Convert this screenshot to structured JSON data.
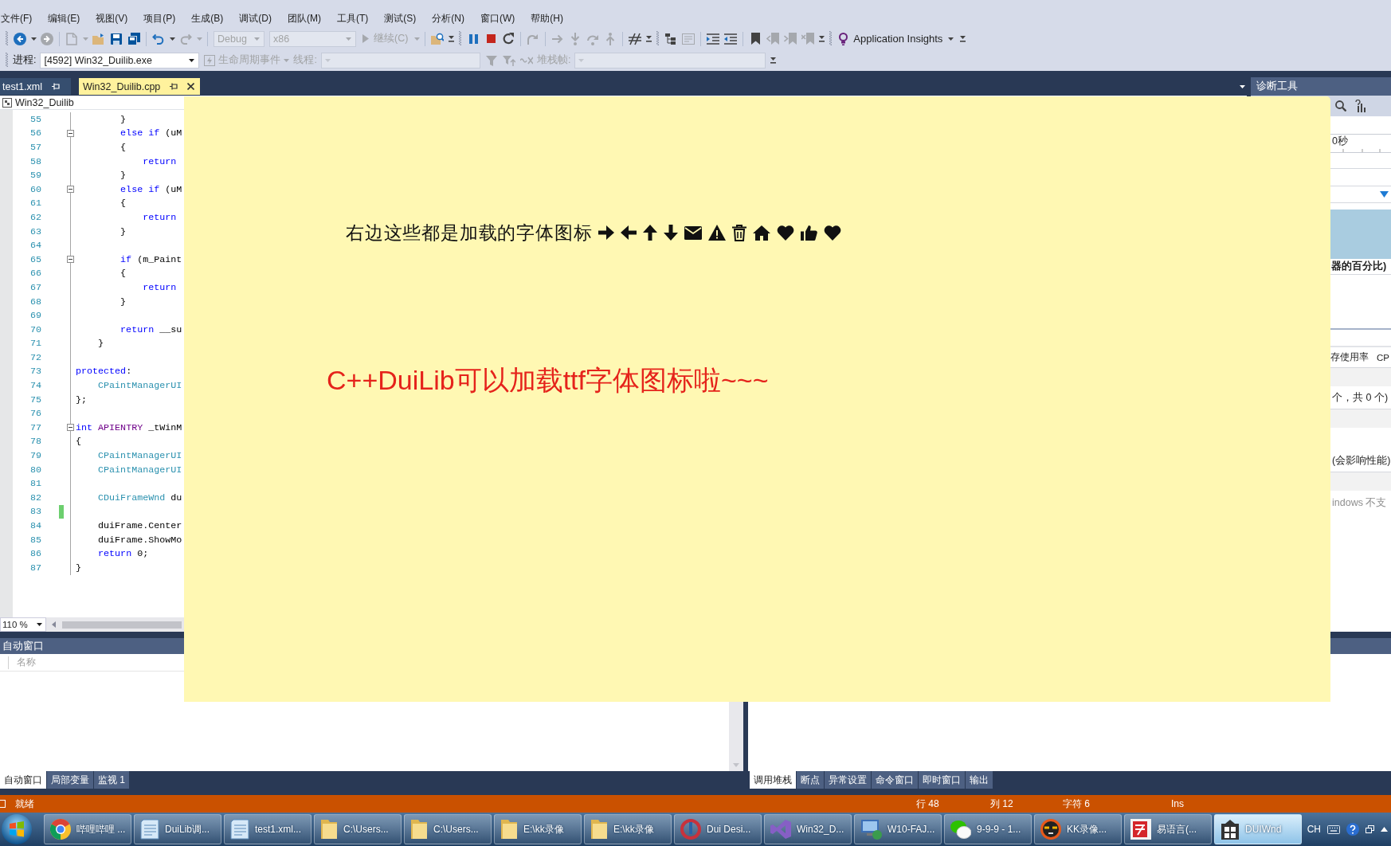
{
  "menu": [
    "文件(F)",
    "编辑(E)",
    "视图(V)",
    "项目(P)",
    "生成(B)",
    "调试(D)",
    "团队(M)",
    "工具(T)",
    "测试(S)",
    "分析(N)",
    "窗口(W)",
    "帮助(H)"
  ],
  "toolbar": [
    {
      "kind": "grip"
    },
    {
      "kind": "back",
      "disabled": false
    },
    {
      "kind": "caret",
      "disabled": false
    },
    {
      "kind": "forward",
      "disabled": true
    },
    {
      "kind": "separator"
    },
    {
      "kind": "new-project",
      "disabled": true
    },
    {
      "kind": "caret",
      "disabled": true
    },
    {
      "kind": "open",
      "disabled": false
    },
    {
      "kind": "save",
      "disabled": false
    },
    {
      "kind": "save-all",
      "disabled": false
    },
    {
      "kind": "separator"
    },
    {
      "kind": "undo",
      "disabled": false
    },
    {
      "kind": "caret",
      "disabled": false
    },
    {
      "kind": "redo",
      "disabled": true
    },
    {
      "kind": "caret",
      "disabled": true
    },
    {
      "kind": "separator"
    },
    {
      "kind": "combo",
      "label": "Debug",
      "disabled": true
    },
    {
      "kind": "combo",
      "label": "x86",
      "disabled": true
    },
    {
      "kind": "run",
      "label": "继续(C)",
      "disabled": true
    },
    {
      "kind": "caret",
      "disabled": true
    },
    {
      "kind": "separator"
    },
    {
      "kind": "find",
      "disabled": false
    },
    {
      "kind": "overflow"
    },
    {
      "kind": "grip"
    },
    {
      "kind": "pause",
      "disabled": false
    },
    {
      "kind": "stop",
      "disabled": false
    },
    {
      "kind": "restart",
      "disabled": false
    },
    {
      "kind": "separator"
    },
    {
      "kind": "show-next",
      "disabled": true
    },
    {
      "kind": "separator"
    },
    {
      "kind": "step-right",
      "disabled": true
    },
    {
      "kind": "step-into",
      "disabled": true
    },
    {
      "kind": "step-over",
      "disabled": true
    },
    {
      "kind": "step-out",
      "disabled": true
    },
    {
      "kind": "separator"
    },
    {
      "kind": "hex",
      "disabled": false
    },
    {
      "kind": "overflow"
    },
    {
      "kind": "grip"
    },
    {
      "kind": "threads",
      "disabled": false
    },
    {
      "kind": "doc-list",
      "disabled": true
    },
    {
      "kind": "separator"
    },
    {
      "kind": "indent",
      "disabled": false
    },
    {
      "kind": "outdent",
      "disabled": false
    },
    {
      "kind": "separator"
    },
    {
      "kind": "bookmark",
      "disabled": false
    },
    {
      "kind": "bookmark-prev",
      "disabled": true
    },
    {
      "kind": "bookmark-next",
      "disabled": true
    },
    {
      "kind": "bookmark-clear",
      "disabled": true
    },
    {
      "kind": "overflow"
    },
    {
      "kind": "grip"
    },
    {
      "kind": "insights",
      "label": "Application Insights",
      "disabled": false
    },
    {
      "kind": "overflow"
    }
  ],
  "debug_location": {
    "process_label": {
      "text": "进程:",
      "disabled": false
    },
    "process": {
      "value": "[4592] Win32_Duilib.exe",
      "disabled": false
    },
    "lifecycle": {
      "label": "生命周期事件",
      "disabled": true
    },
    "thread_label": {
      "text": "线程:",
      "disabled": true
    },
    "thread": {
      "disabled": true
    },
    "filters": [
      {
        "kind": "funnel",
        "disabled": true
      },
      {
        "kind": "funnel-arrow",
        "disabled": true
      },
      {
        "kind": "wave-cross",
        "disabled": true
      }
    ],
    "stack_label": {
      "text": "堆栈帧:",
      "disabled": true
    },
    "stack": {
      "disabled": true
    }
  },
  "document_tabs": [
    {
      "label": "test1.xml",
      "selected": false
    },
    {
      "label": "Win32_Duilib.cpp",
      "selected": true
    }
  ],
  "editor": {
    "navigation": "Win32_Duilib",
    "lines": [
      {
        "number": "55",
        "tokens": [
          {
            "kind": "plain",
            "text": "        }"
          }
        ]
      },
      {
        "number": "56",
        "expanded": true,
        "tokens": [
          {
            "kind": "keyword",
            "text": "        else if"
          },
          {
            "kind": "plain",
            "text": " (uM"
          }
        ]
      },
      {
        "number": "57",
        "tokens": [
          {
            "kind": "plain",
            "text": "        {"
          }
        ]
      },
      {
        "number": "58",
        "tokens": [
          {
            "kind": "keyword",
            "text": "            return"
          }
        ]
      },
      {
        "number": "59",
        "tokens": [
          {
            "kind": "plain",
            "text": "        }"
          }
        ]
      },
      {
        "number": "60",
        "expanded": true,
        "tokens": [
          {
            "kind": "keyword",
            "text": "        else if"
          },
          {
            "kind": "plain",
            "text": " (uM"
          }
        ]
      },
      {
        "number": "61",
        "tokens": [
          {
            "kind": "plain",
            "text": "        {"
          }
        ]
      },
      {
        "number": "62",
        "tokens": [
          {
            "kind": "keyword",
            "text": "            return"
          }
        ]
      },
      {
        "number": "63",
        "tokens": [
          {
            "kind": "plain",
            "text": "        }"
          }
        ]
      },
      {
        "number": "64"
      },
      {
        "number": "65",
        "expanded": true,
        "tokens": [
          {
            "kind": "keyword",
            "text": "        if"
          },
          {
            "kind": "plain",
            "text": " (m_Paint"
          }
        ]
      },
      {
        "number": "66",
        "tokens": [
          {
            "kind": "plain",
            "text": "        {"
          }
        ]
      },
      {
        "number": "67",
        "tokens": [
          {
            "kind": "keyword",
            "text": "            return"
          }
        ]
      },
      {
        "number": "68",
        "tokens": [
          {
            "kind": "plain",
            "text": "        }"
          }
        ]
      },
      {
        "number": "69"
      },
      {
        "number": "70",
        "tokens": [
          {
            "kind": "keyword",
            "text": "        return"
          },
          {
            "kind": "plain",
            "text": " __su"
          }
        ]
      },
      {
        "number": "71",
        "tokens": [
          {
            "kind": "plain",
            "text": "    }"
          }
        ]
      },
      {
        "number": "72"
      },
      {
        "number": "73",
        "tokens": [
          {
            "kind": "keyword",
            "text": "protected"
          },
          {
            "kind": "plain",
            "text": ":"
          }
        ]
      },
      {
        "number": "74",
        "tokens": [
          {
            "kind": "type",
            "text": "    CPaintManagerUI"
          }
        ]
      },
      {
        "number": "75",
        "tokens": [
          {
            "kind": "plain",
            "text": "};"
          }
        ]
      },
      {
        "number": "76"
      },
      {
        "number": "77",
        "expanded": true,
        "tokens": [
          {
            "kind": "keyword",
            "text": "int"
          },
          {
            "kind": "macro",
            "text": " APIENTRY"
          },
          {
            "kind": "plain",
            "text": " _tWinM"
          }
        ]
      },
      {
        "number": "78",
        "tokens": [
          {
            "kind": "plain",
            "text": "{"
          }
        ]
      },
      {
        "number": "79",
        "tokens": [
          {
            "kind": "type",
            "text": "    CPaintManagerUI"
          }
        ]
      },
      {
        "number": "80",
        "tokens": [
          {
            "kind": "type",
            "text": "    CPaintManagerUI"
          }
        ]
      },
      {
        "number": "81"
      },
      {
        "number": "82",
        "tokens": [
          {
            "kind": "type",
            "text": "    CDuiFrameWnd"
          },
          {
            "kind": "plain",
            "text": " du"
          }
        ]
      },
      {
        "number": "83",
        "changed": true
      },
      {
        "number": "84",
        "tokens": [
          {
            "kind": "plain",
            "text": "    duiFrame.Center"
          }
        ]
      },
      {
        "number": "85",
        "tokens": [
          {
            "kind": "plain",
            "text": "    duiFrame.ShowMo"
          }
        ]
      },
      {
        "number": "86",
        "tokens": [
          {
            "kind": "keyword",
            "text": "    return"
          },
          {
            "kind": "plain",
            "text": " 0;"
          }
        ]
      },
      {
        "number": "87",
        "tokens": [
          {
            "kind": "plain",
            "text": "}"
          }
        ]
      }
    ],
    "zoom": "110 %"
  },
  "dui_window": {
    "caption": "右边这些都是加载的字体图标",
    "icons": [
      {
        "kind": "arrow-right"
      },
      {
        "kind": "arrow-left"
      },
      {
        "kind": "arrow-up"
      },
      {
        "kind": "arrow-down"
      },
      {
        "kind": "envelope"
      },
      {
        "kind": "warning"
      },
      {
        "kind": "trash"
      },
      {
        "kind": "home"
      },
      {
        "kind": "heart"
      },
      {
        "kind": "thumbs-up"
      },
      {
        "kind": "heart"
      }
    ],
    "headline": "C++DuiLib可以加载ttf字体图标啦~~~"
  },
  "diagnostic_tools": {
    "title": "诊断工具",
    "timeline_label": "0秒",
    "chart_legend": "器的百分比)",
    "columns": [
      "存使用率",
      "CP"
    ],
    "summary": "个，共 0 个)",
    "option_note": "(会影响性能)",
    "support_note": "indows 不支"
  },
  "autos_window": {
    "title": "自动窗口",
    "column_1": "名称",
    "tabs": [
      {
        "label": "自动窗口",
        "selected": true
      },
      {
        "label": "局部变量",
        "selected": false
      },
      {
        "label": "监视 1",
        "selected": false
      }
    ]
  },
  "call_stack_window": {
    "tabs": [
      {
        "label": "调用堆栈",
        "selected": true
      },
      {
        "label": "断点",
        "selected": false
      },
      {
        "label": "异常设置",
        "selected": false
      },
      {
        "label": "命令窗口",
        "selected": false
      },
      {
        "label": "即时窗口",
        "selected": false
      },
      {
        "label": "输出",
        "selected": false
      }
    ]
  },
  "status_bar": {
    "message": "就绪",
    "line": "行 48",
    "column": "列 12",
    "character": "字符 6",
    "mode": "Ins"
  },
  "taskbar": {
    "buttons": [
      {
        "kind": "browser",
        "label": "哔哩哔哩 ...",
        "selected": false
      },
      {
        "kind": "notepad",
        "label": "DuiLib调...",
        "selected": false
      },
      {
        "kind": "notepad",
        "label": "test1.xml...",
        "selected": false
      },
      {
        "kind": "folder",
        "label": "C:\\Users...",
        "selected": false
      },
      {
        "kind": "folder",
        "label": "C:\\Users...",
        "selected": false
      },
      {
        "kind": "folder",
        "label": "E:\\kk录像",
        "selected": false
      },
      {
        "kind": "folder",
        "label": "E:\\kk录像",
        "selected": false
      },
      {
        "kind": "designer",
        "label": "Dui Desi...",
        "selected": false
      },
      {
        "kind": "studio",
        "label": "Win32_D...",
        "selected": false
      },
      {
        "kind": "remote",
        "label": "W10-FAJ...",
        "selected": false
      },
      {
        "kind": "chat",
        "label": "9-9-9 - 1...",
        "selected": false
      },
      {
        "kind": "recorder",
        "label": "KK录像...",
        "selected": false
      },
      {
        "kind": "language",
        "label": "易语言(...",
        "selected": false
      },
      {
        "kind": "window",
        "label": "DUIWnd",
        "selected": true
      }
    ],
    "tray": {
      "language": "CH"
    }
  }
}
